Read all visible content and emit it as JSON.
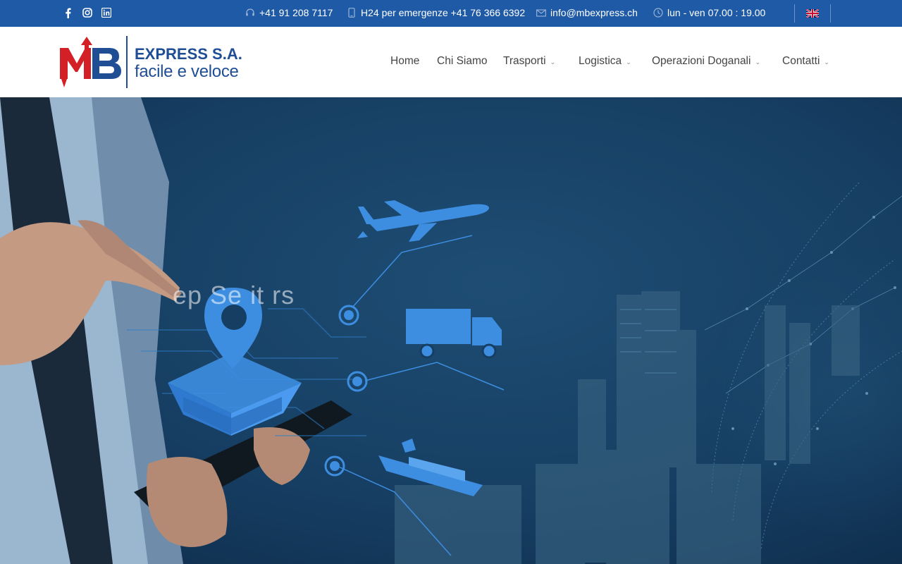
{
  "topbar": {
    "social": [
      {
        "icon": "facebook-icon"
      },
      {
        "icon": "instagram-icon"
      },
      {
        "icon": "linkedin-icon"
      }
    ],
    "phone": "+41 91 208 7117",
    "emergency": "H24 per emergenze +41 76 366 6392",
    "email": "info@mbexpress.ch",
    "hours": "lun - ven 07.00 : 19.00",
    "language_flag": "uk-flag-icon"
  },
  "logo": {
    "line1": "EXPRESS S.A.",
    "line2": "facile e veloce",
    "mark": "MB"
  },
  "nav": {
    "items": [
      {
        "label": "Home",
        "has_dropdown": false
      },
      {
        "label": "Chi Siamo",
        "has_dropdown": false
      },
      {
        "label": "Trasporti",
        "has_dropdown": true
      },
      {
        "label": "Logistica",
        "has_dropdown": true
      },
      {
        "label": "Operazioni Doganali",
        "has_dropdown": true
      },
      {
        "label": "Contatti",
        "has_dropdown": true
      }
    ]
  },
  "hero": {
    "animated_text": "ep Se it rs"
  },
  "colors": {
    "topbar": "#1f5aa6",
    "logo_blue": "#1f4e95",
    "logo_red": "#d32027",
    "hero_bg": "#133a5e",
    "icon_blue": "#3d8ee0"
  }
}
